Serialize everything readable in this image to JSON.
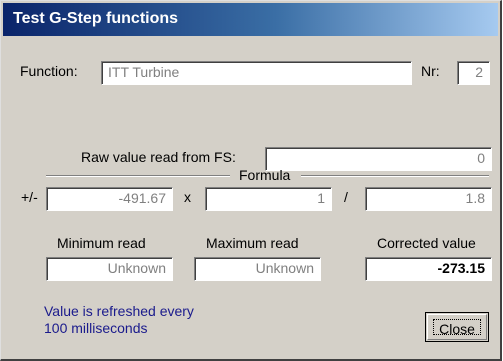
{
  "window": {
    "title": "Test G-Step functions"
  },
  "function": {
    "label": "Function:",
    "value": "ITT Turbine",
    "nr_label": "Nr:",
    "nr_value": "2"
  },
  "raw": {
    "label": "Raw value read from FS:",
    "value": "0"
  },
  "formula": {
    "title": "Formula",
    "offset_label": "+/-",
    "offset_value": "-491.67",
    "multiply_symbol": "x",
    "multiply_value": "1",
    "divide_symbol": "/",
    "divide_value": "1.8"
  },
  "results": {
    "min_label": "Minimum read",
    "min_value": "Unknown",
    "max_label": "Maximum read",
    "max_value": "Unknown",
    "corrected_label": "Corrected value",
    "corrected_value": "-273.15"
  },
  "info": {
    "line1": "Value is refreshed every",
    "line2": "100 milliseconds"
  },
  "buttons": {
    "close": "Close"
  }
}
